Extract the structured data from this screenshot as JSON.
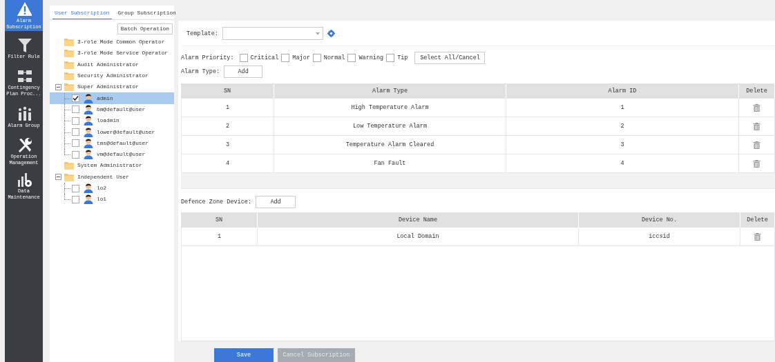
{
  "nav": {
    "items": [
      {
        "label": "Alarm Subscription",
        "selected": true
      },
      {
        "label": "Filter Rule",
        "selected": false
      },
      {
        "label": "Contingency Plan Proc...",
        "selected": false
      },
      {
        "label": "Alarm Group",
        "selected": false
      },
      {
        "label": "Operation Management",
        "selected": false
      },
      {
        "label": "Data Maintenance",
        "selected": false
      }
    ]
  },
  "tabs": [
    {
      "label": "User Subscription",
      "selected": true
    },
    {
      "label": "Group Subscription",
      "selected": false
    }
  ],
  "batch_button": "Batch Operation",
  "tree": [
    {
      "kind": "folder",
      "label": "3-role Mode Common Operator"
    },
    {
      "kind": "folder",
      "label": "3-role Mode Service Operator"
    },
    {
      "kind": "folder",
      "label": "Audit Administrator"
    },
    {
      "kind": "folder",
      "label": "Security Administrator"
    },
    {
      "kind": "folder",
      "label": "Super Administrator",
      "expanded": true,
      "children": [
        {
          "kind": "user",
          "label": "admin",
          "checked": true,
          "selected": true
        },
        {
          "kind": "user",
          "label": "bm@default@user",
          "checked": false,
          "selected": false
        },
        {
          "kind": "user",
          "label": "loadmin",
          "checked": false,
          "selected": false
        },
        {
          "kind": "user",
          "label": "lower@default@user",
          "checked": false,
          "selected": false
        },
        {
          "kind": "user",
          "label": "tms@default@user",
          "checked": false,
          "selected": false
        },
        {
          "kind": "user",
          "label": "vm@default@user",
          "checked": false,
          "selected": false
        }
      ]
    },
    {
      "kind": "folder",
      "label": "System Administrator"
    },
    {
      "kind": "folder",
      "label": "Independent User",
      "expanded": true,
      "children": [
        {
          "kind": "user",
          "label": "lo2",
          "checked": false,
          "selected": false
        },
        {
          "kind": "user",
          "label": "lo1",
          "checked": false,
          "selected": false
        }
      ]
    }
  ],
  "template": {
    "label": "Template:"
  },
  "alarm_priority": {
    "label": "Alarm Priority:",
    "options": [
      {
        "label": "Critical",
        "checked": false
      },
      {
        "label": "Major",
        "checked": false
      },
      {
        "label": "Normal",
        "checked": false
      },
      {
        "label": "Warning",
        "checked": false
      },
      {
        "label": "Tip",
        "checked": false
      }
    ],
    "select_all": "Select All/Cancel"
  },
  "alarm_type": {
    "label": "Alarm Type:",
    "add": "Add"
  },
  "alarm_table": {
    "columns": [
      "SN",
      "Alarm Type",
      "Alarm ID",
      "Delete"
    ],
    "rows": [
      [
        "1",
        "High Temperature Alarm",
        "1"
      ],
      [
        "2",
        "Low Temperature Alarm",
        "2"
      ],
      [
        "3",
        "Temperature Alarm Cleared",
        "3"
      ],
      [
        "4",
        "Fan Fault",
        "4"
      ]
    ]
  },
  "defence_zone": {
    "label": "Defence Zone Device:",
    "add": "Add"
  },
  "device_table": {
    "columns": [
      "SN",
      "Device Name",
      "Device No.",
      "Delete"
    ],
    "rows": [
      [
        "1",
        "Local Domain",
        "iccsid"
      ]
    ]
  },
  "buttons": [
    {
      "label": "Save",
      "disabled": false
    },
    {
      "label": "Cancel Subscription",
      "disabled": true
    }
  ]
}
